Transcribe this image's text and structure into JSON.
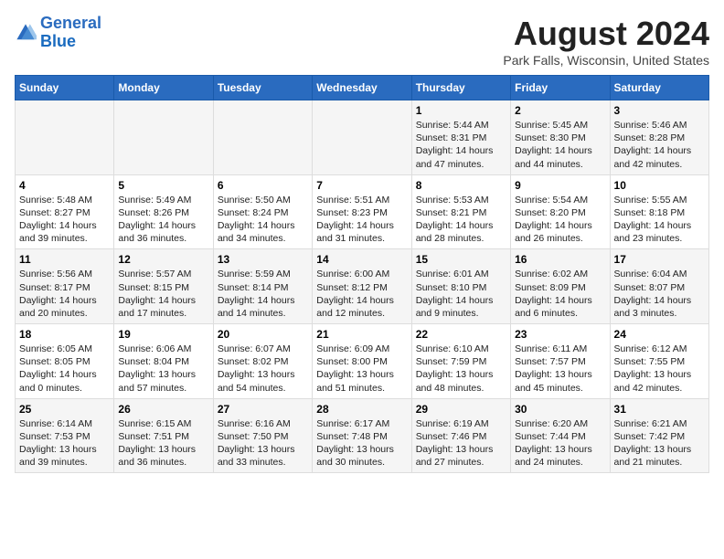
{
  "header": {
    "logo_line1": "General",
    "logo_line2": "Blue",
    "title": "August 2024",
    "subtitle": "Park Falls, Wisconsin, United States"
  },
  "days_of_week": [
    "Sunday",
    "Monday",
    "Tuesday",
    "Wednesday",
    "Thursday",
    "Friday",
    "Saturday"
  ],
  "weeks": [
    [
      {
        "day": "",
        "content": ""
      },
      {
        "day": "",
        "content": ""
      },
      {
        "day": "",
        "content": ""
      },
      {
        "day": "",
        "content": ""
      },
      {
        "day": "1",
        "content": "Sunrise: 5:44 AM\nSunset: 8:31 PM\nDaylight: 14 hours\nand 47 minutes."
      },
      {
        "day": "2",
        "content": "Sunrise: 5:45 AM\nSunset: 8:30 PM\nDaylight: 14 hours\nand 44 minutes."
      },
      {
        "day": "3",
        "content": "Sunrise: 5:46 AM\nSunset: 8:28 PM\nDaylight: 14 hours\nand 42 minutes."
      }
    ],
    [
      {
        "day": "4",
        "content": "Sunrise: 5:48 AM\nSunset: 8:27 PM\nDaylight: 14 hours\nand 39 minutes."
      },
      {
        "day": "5",
        "content": "Sunrise: 5:49 AM\nSunset: 8:26 PM\nDaylight: 14 hours\nand 36 minutes."
      },
      {
        "day": "6",
        "content": "Sunrise: 5:50 AM\nSunset: 8:24 PM\nDaylight: 14 hours\nand 34 minutes."
      },
      {
        "day": "7",
        "content": "Sunrise: 5:51 AM\nSunset: 8:23 PM\nDaylight: 14 hours\nand 31 minutes."
      },
      {
        "day": "8",
        "content": "Sunrise: 5:53 AM\nSunset: 8:21 PM\nDaylight: 14 hours\nand 28 minutes."
      },
      {
        "day": "9",
        "content": "Sunrise: 5:54 AM\nSunset: 8:20 PM\nDaylight: 14 hours\nand 26 minutes."
      },
      {
        "day": "10",
        "content": "Sunrise: 5:55 AM\nSunset: 8:18 PM\nDaylight: 14 hours\nand 23 minutes."
      }
    ],
    [
      {
        "day": "11",
        "content": "Sunrise: 5:56 AM\nSunset: 8:17 PM\nDaylight: 14 hours\nand 20 minutes."
      },
      {
        "day": "12",
        "content": "Sunrise: 5:57 AM\nSunset: 8:15 PM\nDaylight: 14 hours\nand 17 minutes."
      },
      {
        "day": "13",
        "content": "Sunrise: 5:59 AM\nSunset: 8:14 PM\nDaylight: 14 hours\nand 14 minutes."
      },
      {
        "day": "14",
        "content": "Sunrise: 6:00 AM\nSunset: 8:12 PM\nDaylight: 14 hours\nand 12 minutes."
      },
      {
        "day": "15",
        "content": "Sunrise: 6:01 AM\nSunset: 8:10 PM\nDaylight: 14 hours\nand 9 minutes."
      },
      {
        "day": "16",
        "content": "Sunrise: 6:02 AM\nSunset: 8:09 PM\nDaylight: 14 hours\nand 6 minutes."
      },
      {
        "day": "17",
        "content": "Sunrise: 6:04 AM\nSunset: 8:07 PM\nDaylight: 14 hours\nand 3 minutes."
      }
    ],
    [
      {
        "day": "18",
        "content": "Sunrise: 6:05 AM\nSunset: 8:05 PM\nDaylight: 14 hours\nand 0 minutes."
      },
      {
        "day": "19",
        "content": "Sunrise: 6:06 AM\nSunset: 8:04 PM\nDaylight: 13 hours\nand 57 minutes."
      },
      {
        "day": "20",
        "content": "Sunrise: 6:07 AM\nSunset: 8:02 PM\nDaylight: 13 hours\nand 54 minutes."
      },
      {
        "day": "21",
        "content": "Sunrise: 6:09 AM\nSunset: 8:00 PM\nDaylight: 13 hours\nand 51 minutes."
      },
      {
        "day": "22",
        "content": "Sunrise: 6:10 AM\nSunset: 7:59 PM\nDaylight: 13 hours\nand 48 minutes."
      },
      {
        "day": "23",
        "content": "Sunrise: 6:11 AM\nSunset: 7:57 PM\nDaylight: 13 hours\nand 45 minutes."
      },
      {
        "day": "24",
        "content": "Sunrise: 6:12 AM\nSunset: 7:55 PM\nDaylight: 13 hours\nand 42 minutes."
      }
    ],
    [
      {
        "day": "25",
        "content": "Sunrise: 6:14 AM\nSunset: 7:53 PM\nDaylight: 13 hours\nand 39 minutes."
      },
      {
        "day": "26",
        "content": "Sunrise: 6:15 AM\nSunset: 7:51 PM\nDaylight: 13 hours\nand 36 minutes."
      },
      {
        "day": "27",
        "content": "Sunrise: 6:16 AM\nSunset: 7:50 PM\nDaylight: 13 hours\nand 33 minutes."
      },
      {
        "day": "28",
        "content": "Sunrise: 6:17 AM\nSunset: 7:48 PM\nDaylight: 13 hours\nand 30 minutes."
      },
      {
        "day": "29",
        "content": "Sunrise: 6:19 AM\nSunset: 7:46 PM\nDaylight: 13 hours\nand 27 minutes."
      },
      {
        "day": "30",
        "content": "Sunrise: 6:20 AM\nSunset: 7:44 PM\nDaylight: 13 hours\nand 24 minutes."
      },
      {
        "day": "31",
        "content": "Sunrise: 6:21 AM\nSunset: 7:42 PM\nDaylight: 13 hours\nand 21 minutes."
      }
    ]
  ]
}
